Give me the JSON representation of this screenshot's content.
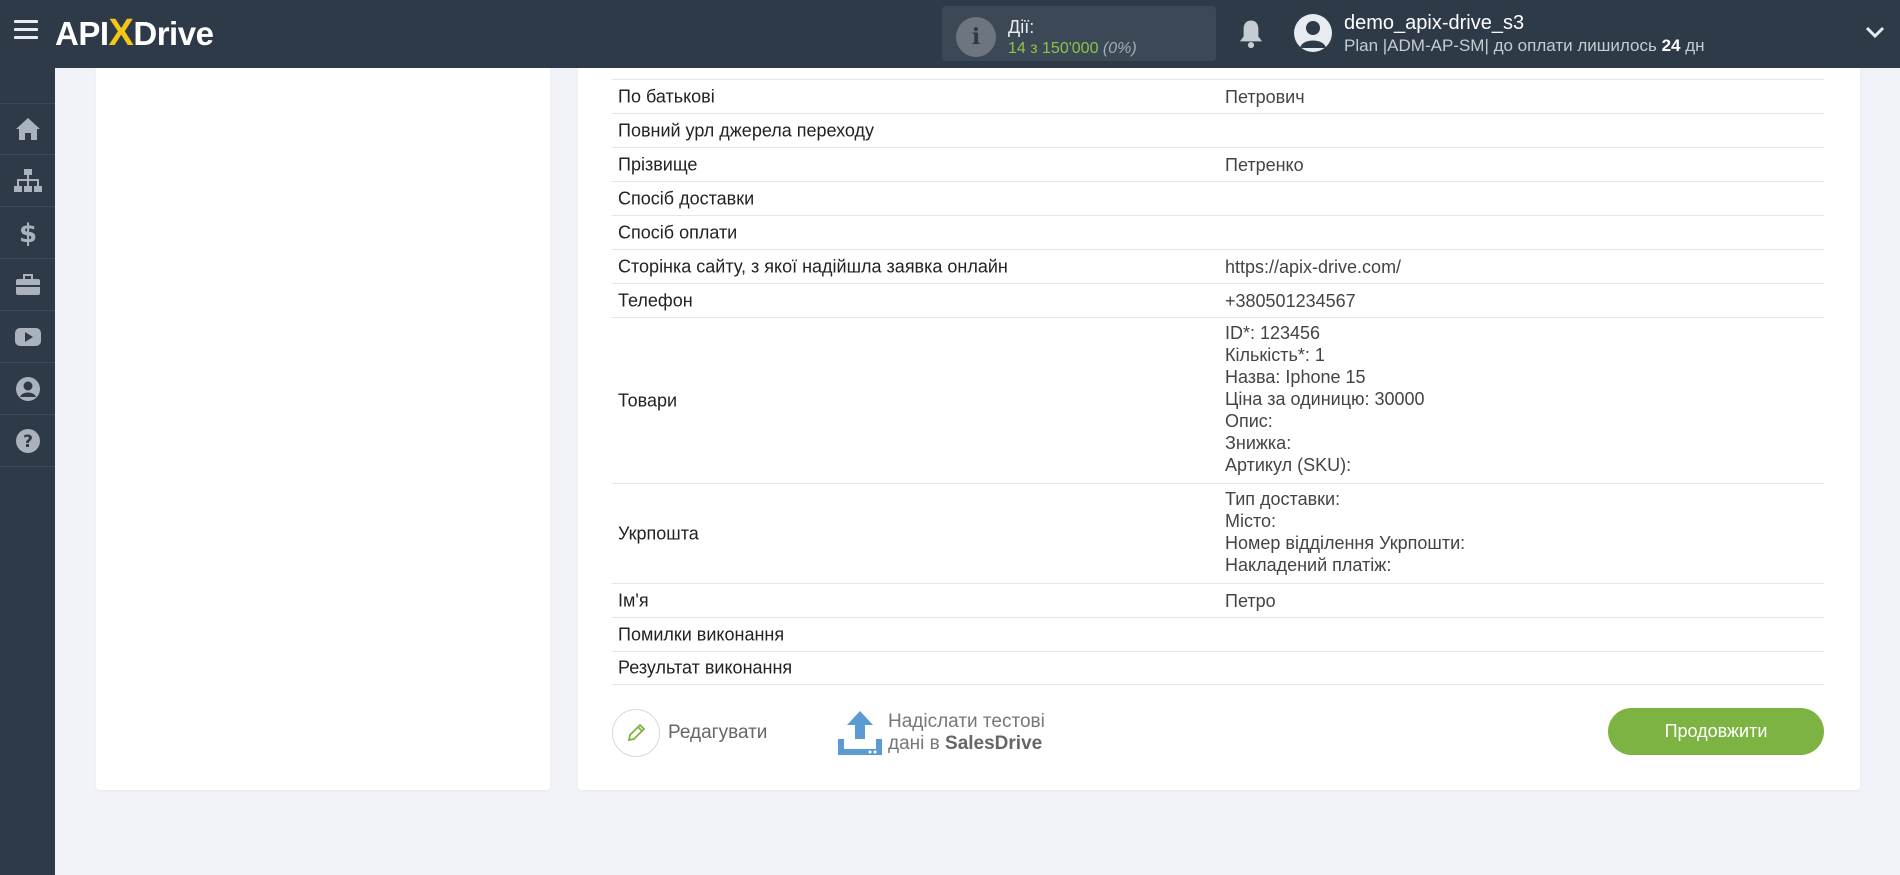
{
  "brand": {
    "logo_left": "API",
    "logo_x": "X",
    "logo_right": "Drive"
  },
  "header": {
    "actions_label": "Дії:",
    "actions_count": "14 з 150'000",
    "actions_pct": "(0%)",
    "user_name": "demo_apix-drive_s3",
    "plan_prefix": "Plan |ADM-AP-SM| до оплати лишилось",
    "plan_days": "24",
    "plan_suffix": "дн"
  },
  "sidebar": {
    "items": [
      {
        "icon": "home-icon"
      },
      {
        "icon": "sitemap-icon"
      },
      {
        "icon": "dollar-icon"
      },
      {
        "icon": "briefcase-icon"
      },
      {
        "icon": "youtube-icon"
      },
      {
        "icon": "user-circle-icon"
      },
      {
        "icon": "question-circle-icon"
      }
    ]
  },
  "table": {
    "rows": [
      {
        "key": "По батькові",
        "value": [
          "Петрович"
        ]
      },
      {
        "key": "Повний урл джерела переходу",
        "value": []
      },
      {
        "key": "Прізвище",
        "value": [
          "Петренко"
        ]
      },
      {
        "key": "Спосіб доставки",
        "value": []
      },
      {
        "key": "Спосіб оплати",
        "value": []
      },
      {
        "key": "Сторінка сайту, з якої надійшла заявка онлайн",
        "value": [
          "https://apix-drive.com/"
        ]
      },
      {
        "key": "Телефон",
        "value": [
          "+380501234567"
        ]
      },
      {
        "key": "Товари",
        "value": [
          "ID*: 123456",
          "Кількість*: 1",
          "Назва: Iphone 15",
          "Ціна за одиницю: 30000",
          "Опис:",
          "Знижка:",
          "Артикул (SKU):"
        ]
      },
      {
        "key": "Укрпошта",
        "value": [
          "Тип доставки:",
          "Місто:",
          "Номер відділення Укрпошти:",
          "Накладений платіж:"
        ]
      },
      {
        "key": "Ім'я",
        "value": [
          "Петро"
        ]
      },
      {
        "key": "Помилки виконання",
        "value": []
      },
      {
        "key": "Результат виконання",
        "value": []
      }
    ]
  },
  "buttons": {
    "edit": "Редагувати",
    "send_line1": "Надіслати тестові",
    "send_line2_prefix": "дані в",
    "send_service": "SalesDrive",
    "continue": "Продовжити"
  },
  "colors": {
    "accent": "#7cb342",
    "header_bg": "#2e3a48",
    "page_bg": "#f1f3f8"
  }
}
